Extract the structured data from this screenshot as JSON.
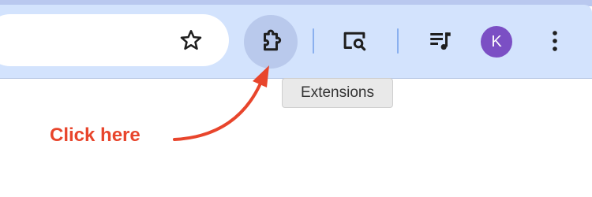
{
  "toolbar": {
    "star_icon": "star-icon",
    "extensions_icon": "puzzle-piece-icon",
    "lens_icon": "screen-search-icon",
    "media_icon": "media-queue-icon",
    "menu_icon": "vertical-dots-icon",
    "profile": {
      "initial": "K",
      "color": "#7b4fc4"
    }
  },
  "tooltip": {
    "text": "Extensions"
  },
  "annotation": {
    "text": "Click here",
    "color": "#e8452c"
  },
  "colors": {
    "toolbar_bg": "#d3e3fd",
    "top_strip": "#b9c8ef",
    "extensions_hover_bg": "#b9c9ec",
    "separator": "#8ab0ef",
    "icon": "#1f1f1f"
  }
}
